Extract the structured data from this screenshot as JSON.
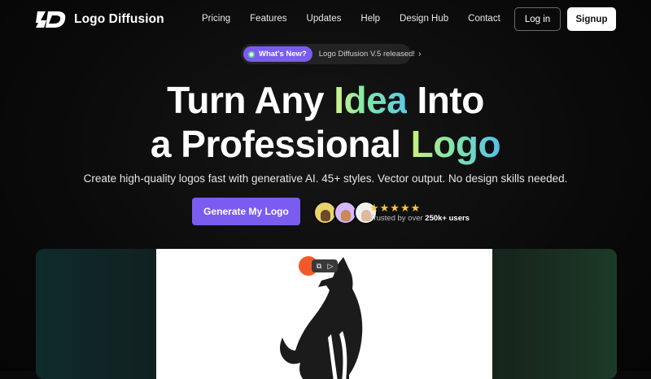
{
  "brand": {
    "name": "Logo Diffusion"
  },
  "nav": {
    "links": [
      "Pricing",
      "Features",
      "Updates",
      "Help",
      "Design Hub",
      "Contact"
    ],
    "login": "Log in",
    "signup": "Signup"
  },
  "announcement": {
    "badge": "What's New?",
    "text": "Logo Diffusion V.5 released!",
    "chevron": "›"
  },
  "hero": {
    "line1_pre": "Turn Any ",
    "line1_accent": "Idea",
    "line1_post": " Into",
    "line2_pre": "a Professional ",
    "line2_accent": "Logo",
    "subtitle": "Create high-quality logos fast with generative AI. 45+ styles. Vector output. No design skills needed.",
    "cta": "Generate My Logo"
  },
  "social_proof": {
    "stars": "★★★★★",
    "rating": 5,
    "trusted_pre": "Trusted by over ",
    "trusted_count": "250k+ users"
  },
  "colors": {
    "accent": "#7a5cf0",
    "star": "#f7c83c",
    "orange": "#f05a28"
  },
  "icons": [
    "logo-mark-icon",
    "chevron-right-icon",
    "star-icon",
    "image-tool-icon",
    "video-tool-icon"
  ]
}
